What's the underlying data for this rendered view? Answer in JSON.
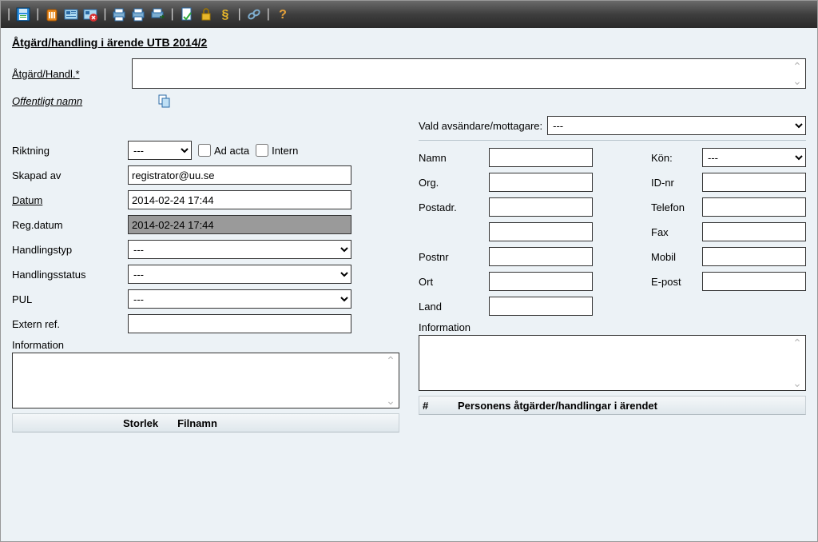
{
  "title": "Åtgärd/handling i ärende UTB 2014/2",
  "labels": {
    "atgard_handl": "Åtgärd/Handl.*",
    "offentligt_namn": "Offentligt namn",
    "riktning": "Riktning",
    "ad_acta": "Ad acta",
    "intern": "Intern",
    "skapad_av": "Skapad av",
    "datum": "Datum",
    "reg_datum": "Reg.datum",
    "handlingstyp": "Handlingstyp",
    "handlingsstatus": "Handlingsstatus",
    "pul": "PUL",
    "extern_ref": "Extern ref.",
    "information": "Information",
    "storlek": "Storlek",
    "filnamn": "Filnamn",
    "vald_avsandare": "Vald avsändare/mottagare:",
    "namn": "Namn",
    "kon": "Kön:",
    "org": "Org.",
    "id_nr": "ID-nr",
    "postadr": "Postadr.",
    "telefon": "Telefon",
    "fax": "Fax",
    "postnr": "Postnr",
    "mobil": "Mobil",
    "ort": "Ort",
    "epost": "E-post",
    "land": "Land",
    "hash": "#",
    "personens": "Personens åtgärder/handlingar i ärendet"
  },
  "values": {
    "riktning": "---",
    "skapad_av": "registrator@uu.se",
    "datum": "2014-02-24 17:44",
    "reg_datum": "2014-02-24 17:44",
    "handlingstyp": "---",
    "handlingsstatus": "---",
    "pul": "---",
    "vald_avsandare": "---",
    "kon": "---"
  }
}
